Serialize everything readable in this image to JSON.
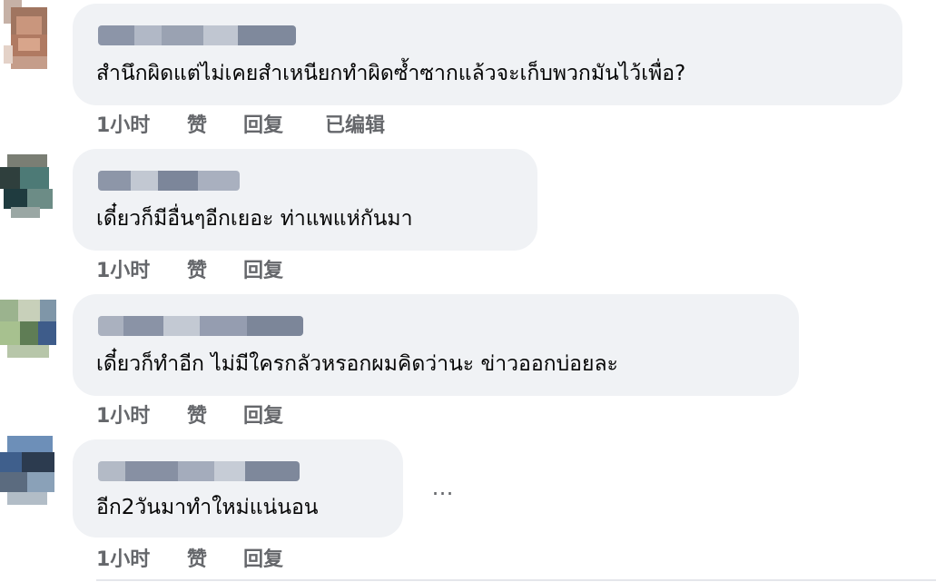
{
  "comments": [
    {
      "text": "สำนึกผิดแต่ไม่เคยสำเหนียกทำผิดซ้ำซากแล้วจะเก็บพวกมันไว้เพื่อ?",
      "time": "1小时",
      "like": "赞",
      "reply": "回复",
      "edited": "已编辑"
    },
    {
      "text": "เดี๋ยวก็มีอื่นๆอีกเยอะ ท่าแพแห่กันมา",
      "time": "1小时",
      "like": "赞",
      "reply": "回复"
    },
    {
      "text": "เดี๋ยวก็ทำอีก ไม่มีใครกลัวหรอกผมคิดว่านะ ข่าวออกบ่อยละ",
      "time": "1小时",
      "like": "赞",
      "reply": "回复"
    },
    {
      "text": "อีก2วันมาทำใหม่แน่นอน",
      "time": "1小时",
      "like": "赞",
      "reply": "回复"
    }
  ],
  "more_icon": "…",
  "colors": {
    "bubble": "#f0f2f5",
    "text": "#050505",
    "secondary": "#65676b"
  }
}
